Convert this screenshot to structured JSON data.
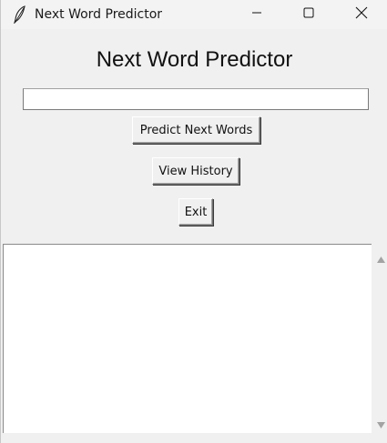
{
  "window": {
    "title": "Next Word Predictor",
    "icon": "feather-icon",
    "controls": [
      "minimize-icon",
      "maximize-icon",
      "close-icon"
    ]
  },
  "app": {
    "heading": "Next Word Predictor",
    "input": {
      "value": "",
      "placeholder": ""
    },
    "buttons": {
      "predict": "Predict Next Words",
      "history": "View History",
      "exit": "Exit"
    },
    "output": {
      "text": ""
    }
  }
}
